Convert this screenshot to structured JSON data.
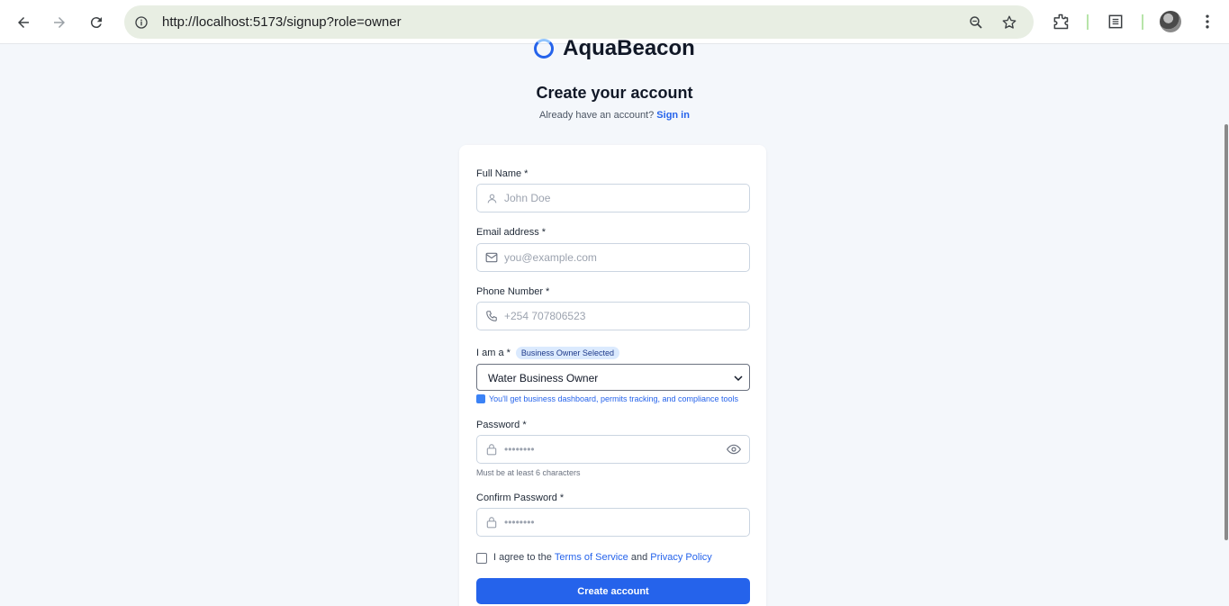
{
  "browser": {
    "url": "http://localhost:5173/signup?role=owner",
    "icons": [
      "back-arrow-icon",
      "forward-arrow-icon",
      "reload-icon",
      "site-info-icon",
      "zoom-icon",
      "bookmark-star-icon",
      "extensions-icon",
      "reading-list-icon",
      "profile-avatar",
      "menu-kebab-icon"
    ]
  },
  "brand": {
    "name": "AquaBeacon"
  },
  "header": {
    "title": "Create your account",
    "subtitle_prefix": "Already have an account?",
    "signin_link": "Sign in"
  },
  "form": {
    "full_name": {
      "label": "Full Name *",
      "placeholder": "John Doe"
    },
    "email": {
      "label": "Email address *",
      "placeholder": "you@example.com"
    },
    "phone": {
      "label": "Phone Number *",
      "placeholder": "+254 707806523"
    },
    "role": {
      "label": "I am a *",
      "badge": "Business Owner Selected",
      "selected": "Water Business Owner",
      "hint": "You'll get business dashboard, permits tracking, and compliance tools"
    },
    "password": {
      "label": "Password *",
      "placeholder": "••••••••",
      "hint": "Must be at least 6 characters"
    },
    "confirm_password": {
      "label": "Confirm Password *",
      "placeholder": "••••••••"
    },
    "agree": {
      "prefix": "I agree to the",
      "terms": "Terms of Service",
      "and": "and",
      "privacy": "Privacy Policy"
    },
    "submit_label": "Create account"
  },
  "colors": {
    "primary": "#2563eb",
    "page_bg": "#f4f7fb",
    "badge_bg": "#dbeafe",
    "omnibox_bg": "#e8eee3"
  }
}
